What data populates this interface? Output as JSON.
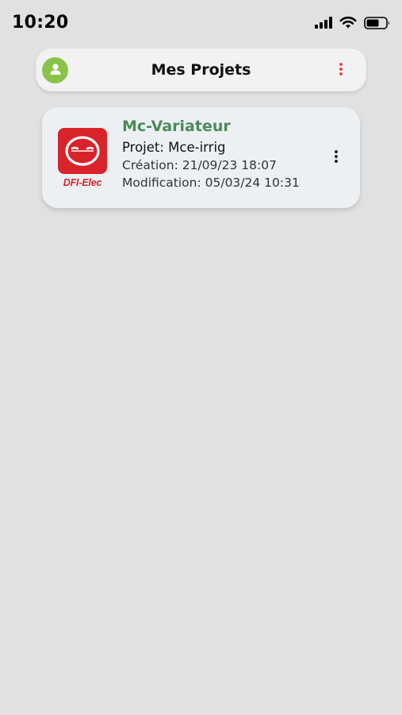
{
  "status_bar": {
    "time": "10:20",
    "icons": [
      "signal-icon",
      "wifi-icon",
      "battery-icon"
    ]
  },
  "header": {
    "title": "Mes Projets",
    "avatar_icon": "person-icon",
    "menu_icon": "more-vert-icon",
    "avatar_color": "#8bc34a",
    "menu_color": "#e53935"
  },
  "projects": [
    {
      "name": "Mc-Variateur",
      "project_line": "Projet: Mce-irrig",
      "created_line": "Création: 21/09/23 18:07",
      "modified_line": "Modification: 05/03/24 10:31",
      "logo_text": "DFI-Elec",
      "logo_color": "#d9232a",
      "title_color": "#4b8a5b",
      "menu_icon": "more-vert-icon"
    }
  ]
}
